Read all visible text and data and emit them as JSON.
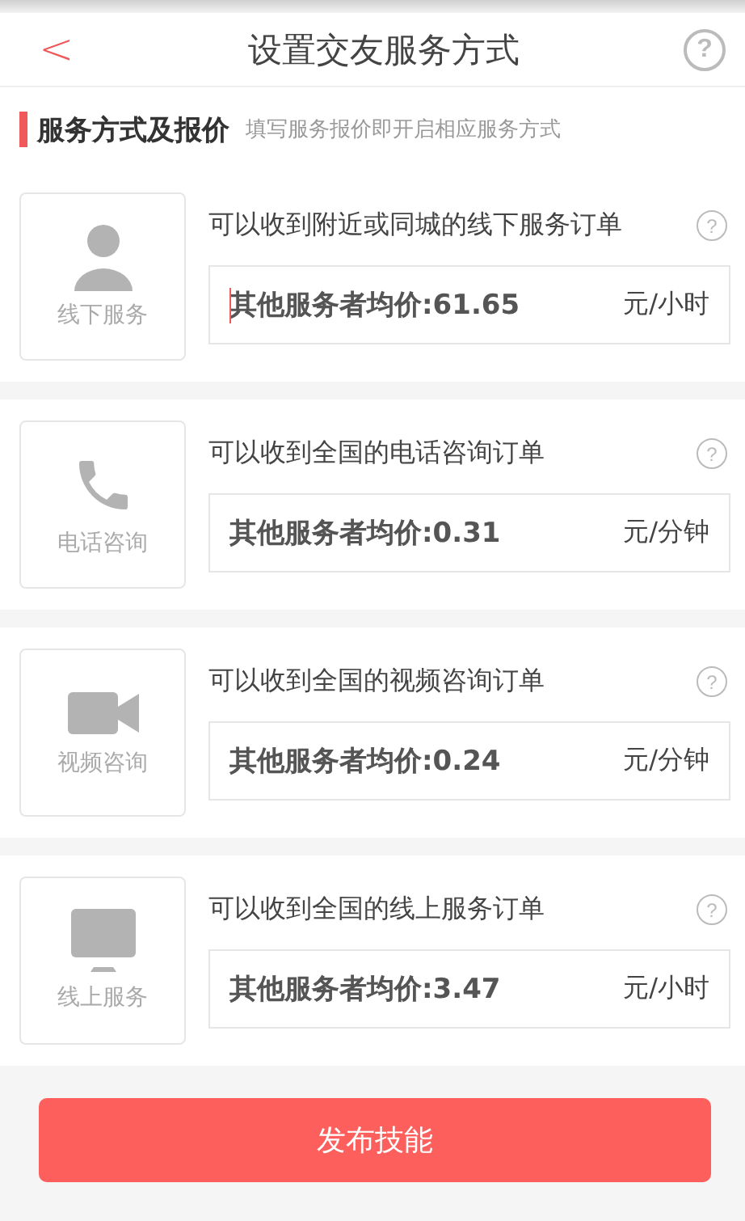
{
  "header": {
    "back": "<",
    "title": "设置交友服务方式",
    "help": "?"
  },
  "section": {
    "title": "服务方式及报价",
    "hint": "填写服务报价即开启相应服务方式"
  },
  "services": [
    {
      "kind": "offline",
      "label": "线下服务",
      "description": "可以收到附近或同城的线下服务订单",
      "placeholder": "其他服务者均价:61.65",
      "unit": "元/小时",
      "focused": true
    },
    {
      "kind": "phone",
      "label": "电话咨询",
      "description": "可以收到全国的电话咨询订单",
      "placeholder": "其他服务者均价:0.31",
      "unit": "元/分钟",
      "focused": false
    },
    {
      "kind": "video",
      "label": "视频咨询",
      "description": "可以收到全国的视频咨询订单",
      "placeholder": "其他服务者均价:0.24",
      "unit": "元/分钟",
      "focused": false
    },
    {
      "kind": "online",
      "label": "线上服务",
      "description": "可以收到全国的线上服务订单",
      "placeholder": "其他服务者均价:3.47",
      "unit": "元/小时",
      "focused": false
    }
  ],
  "submit": "发布技能"
}
